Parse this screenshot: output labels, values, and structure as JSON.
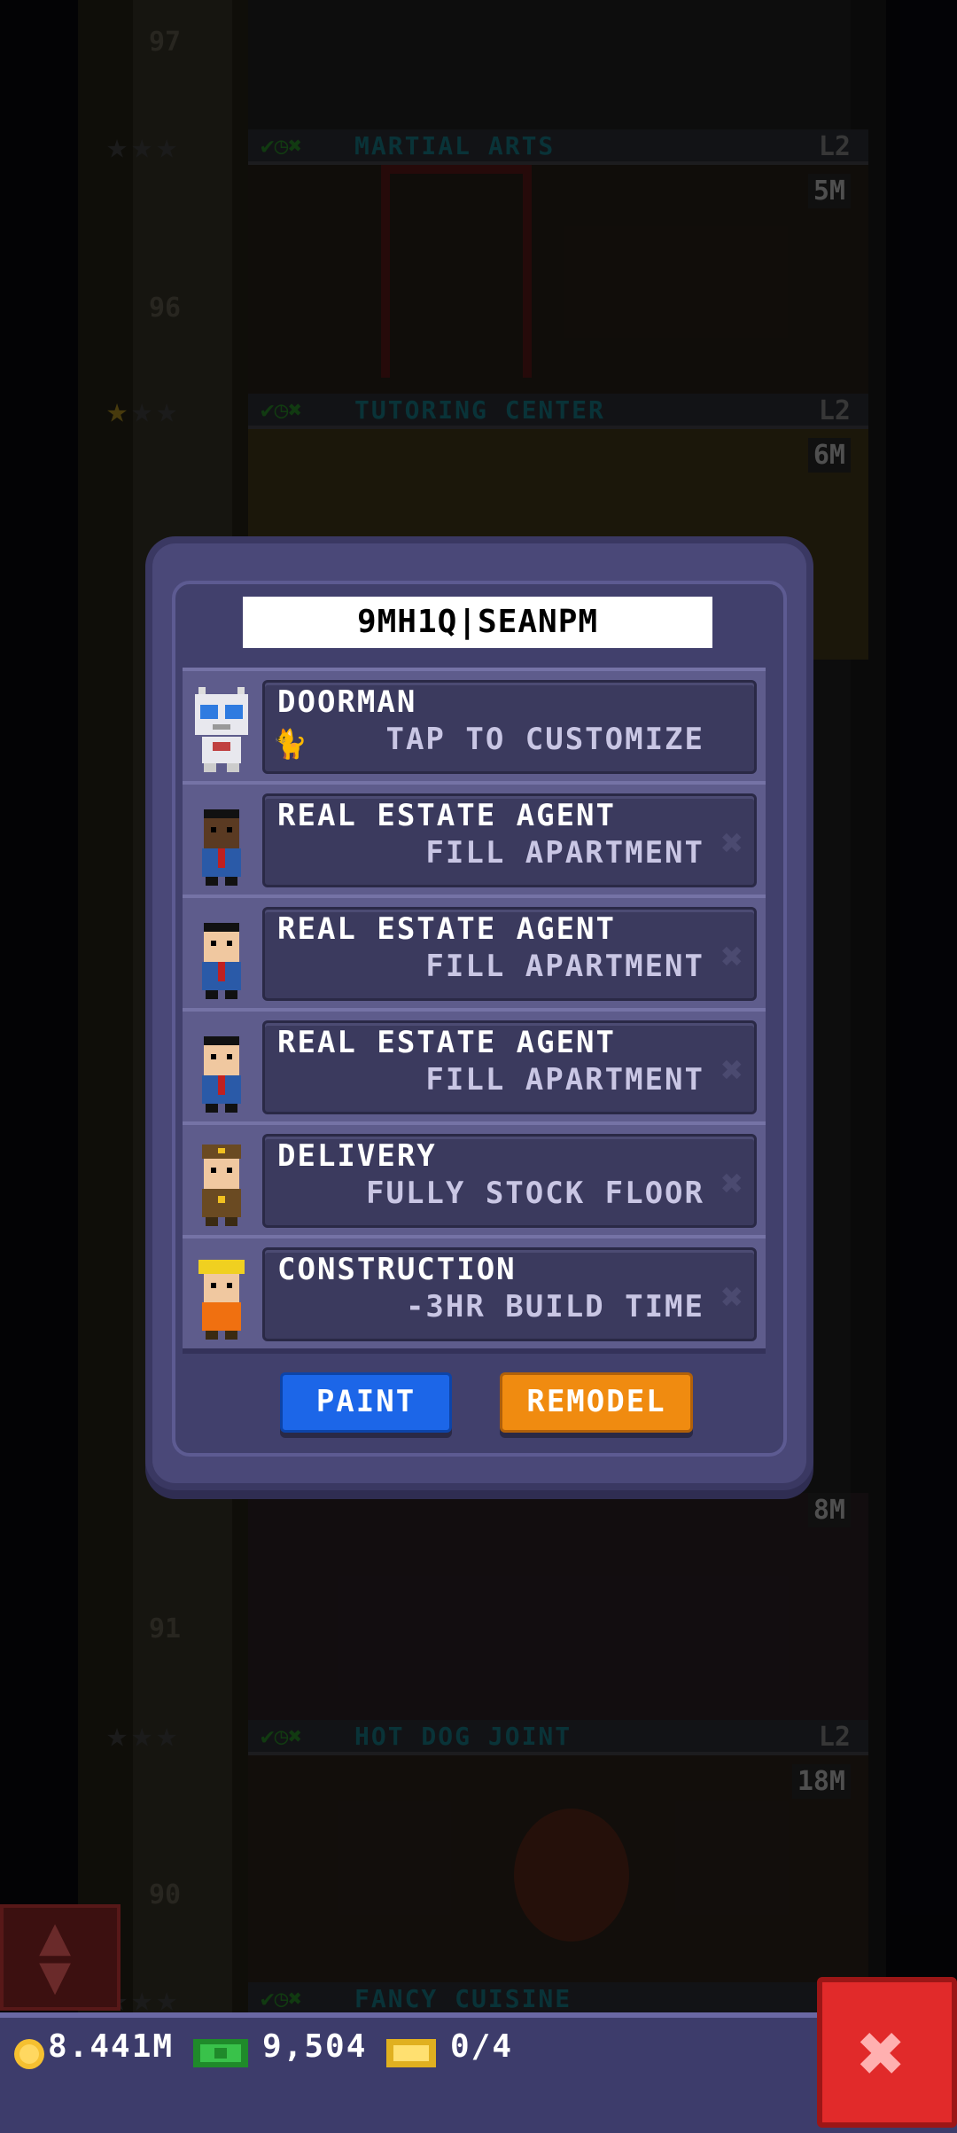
{
  "background": {
    "floors": [
      {
        "number": "97",
        "name": "MARTIAL ARTS",
        "level": "L2",
        "price": "5M",
        "stars_on": 0
      },
      {
        "number": "96",
        "name": "TUTORING CENTER",
        "level": "L2",
        "price": "6M",
        "stars_on": 1
      },
      {
        "number": "91",
        "name": "",
        "level": "",
        "price": "8M",
        "stars_on": 0
      },
      {
        "number": "90",
        "name": "HOT DOG JOINT",
        "level": "L2",
        "price": "18M",
        "stars_on": 0
      },
      {
        "number": "",
        "name": "FANCY CUISINE",
        "level": "",
        "price": "",
        "stars_on": 0
      }
    ]
  },
  "dialog": {
    "name_value": "9MH1Q|SEANPM",
    "rows": [
      {
        "title": "DOORMAN",
        "subtitle": "TAP TO CUSTOMIZE",
        "icon": "robot-doorman-icon",
        "removable": false
      },
      {
        "title": "REAL ESTATE AGENT",
        "subtitle": "FILL APARTMENT",
        "icon": "agent-icon",
        "removable": true
      },
      {
        "title": "REAL ESTATE AGENT",
        "subtitle": "FILL APARTMENT",
        "icon": "agent-icon",
        "removable": true
      },
      {
        "title": "REAL ESTATE AGENT",
        "subtitle": "FILL APARTMENT",
        "icon": "agent-icon",
        "removable": true
      },
      {
        "title": "DELIVERY",
        "subtitle": "FULLY STOCK FLOOR",
        "icon": "delivery-icon",
        "removable": true
      },
      {
        "title": "CONSTRUCTION",
        "subtitle": "-3HR BUILD TIME",
        "icon": "construction-icon",
        "removable": true
      }
    ],
    "paint_label": "PAINT",
    "remodel_label": "REMODEL",
    "colors": {
      "paint": "#1c66e8",
      "remodel": "#f08b10"
    }
  },
  "status": {
    "coins": "8.441M",
    "bux": "9,504",
    "tickets": "0/4"
  },
  "icons": {
    "coin": "coin-icon",
    "bux": "tower-bux-icon",
    "ticket": "golden-ticket-icon",
    "close": "close-icon",
    "scroll": "elevator-scroll-icon"
  }
}
